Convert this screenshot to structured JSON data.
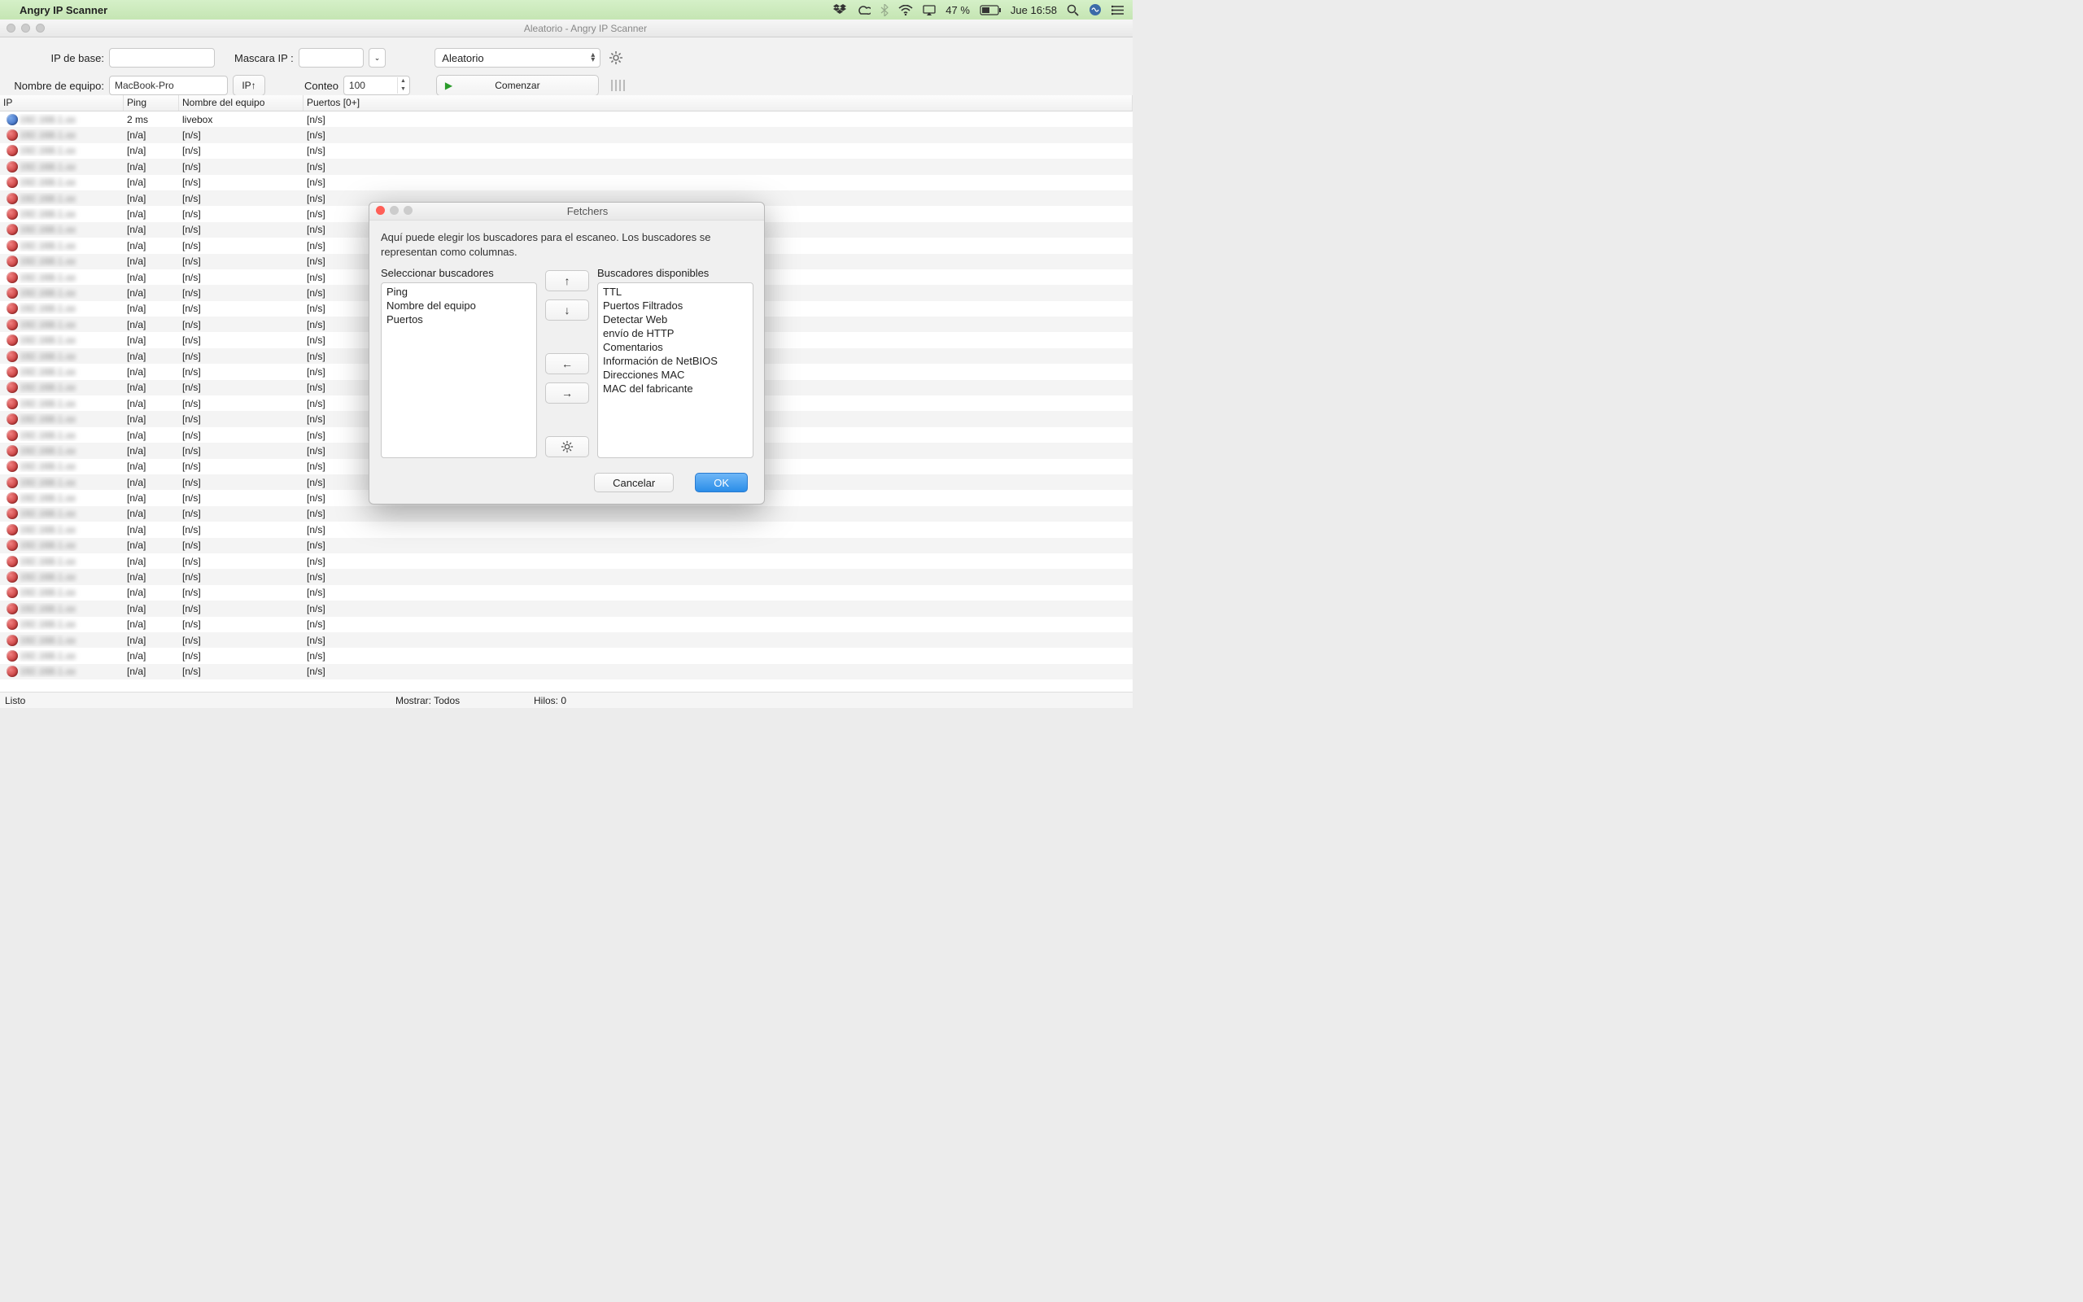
{
  "menubar": {
    "app_name": "Angry IP Scanner",
    "battery_pct": "47 %",
    "clock": "Jue 16:58"
  },
  "window": {
    "title": "Aleatorio - Angry IP Scanner"
  },
  "toolbar": {
    "ip_base_label": "IP de base:",
    "ip_base_value": "",
    "mask_label": "Mascara IP :",
    "mask_value": "",
    "mode_value": "Aleatorio",
    "hostname_label": "Nombre de equipo:",
    "hostname_value": "MacBook-Pro",
    "ip_up_label": "IP↑",
    "count_label": "Conteo",
    "count_value": "100",
    "start_label": "Comenzar"
  },
  "table": {
    "headers": {
      "ip": "IP",
      "ping": "Ping",
      "host": "Nombre del equipo",
      "ports": "Puertos [0+]"
    },
    "first_row": {
      "ping": "2 ms",
      "host": "livebox",
      "ports": "[n/s]"
    },
    "na": "[n/a]",
    "ns": "[n/s]",
    "dead_rows": 35
  },
  "statusbar": {
    "ready": "Listo",
    "show": "Mostrar: Todos",
    "threads": "Hilos: 0"
  },
  "modal": {
    "title": "Fetchers",
    "description": "Aquí puede elegir los buscadores para el escaneo. Los buscadores se representan como columnas.",
    "selected_label": "Seleccionar buscadores",
    "available_label": "Buscadores disponibles",
    "selected": [
      "Ping",
      "Nombre del equipo",
      "Puertos"
    ],
    "available": [
      "TTL",
      "Puertos Filtrados",
      "Detectar Web",
      "envío de HTTP",
      "Comentarios",
      "Información de NetBIOS",
      "Direcciones MAC",
      "MAC del fabricante"
    ],
    "cancel": "Cancelar",
    "ok": "OK"
  }
}
